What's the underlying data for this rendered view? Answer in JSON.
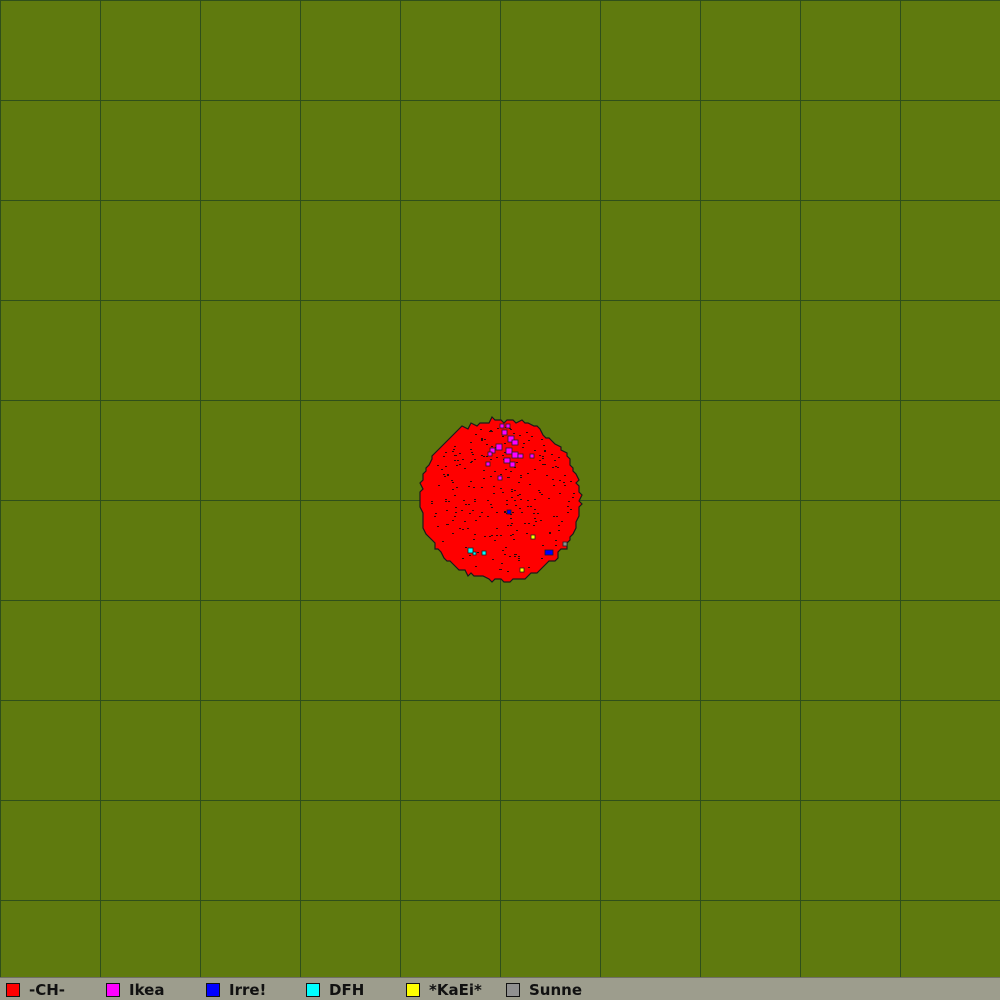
{
  "map": {
    "background_color": "#5f7a0e",
    "grid_color": "#2f4f1a",
    "grid_lines": true,
    "territory": {
      "owner": "-CH-",
      "color": "#ff0000"
    },
    "enclaves": [
      {
        "owner": "Ikea",
        "color": "#ff00ff",
        "area": "north cluster"
      },
      {
        "owner": "Irre!",
        "color": "#0000ff",
        "area": "center / south-east"
      },
      {
        "owner": "DFH",
        "color": "#00ffff",
        "area": "south-west"
      },
      {
        "owner": "*KaEi*",
        "color": "#ffff00",
        "area": "south-east"
      },
      {
        "owner": "Sunne",
        "color": "#909090",
        "area": "east edge"
      }
    ]
  },
  "legend": {
    "items": [
      {
        "label": "-CH-",
        "color": "#ff0000"
      },
      {
        "label": "Ikea",
        "color": "#ff00ff"
      },
      {
        "label": "Irre!",
        "color": "#0000ff"
      },
      {
        "label": "DFH",
        "color": "#00ffff"
      },
      {
        "label": "*KaEi*",
        "color": "#ffff00"
      },
      {
        "label": "Sunne",
        "color": "#909090"
      }
    ]
  }
}
